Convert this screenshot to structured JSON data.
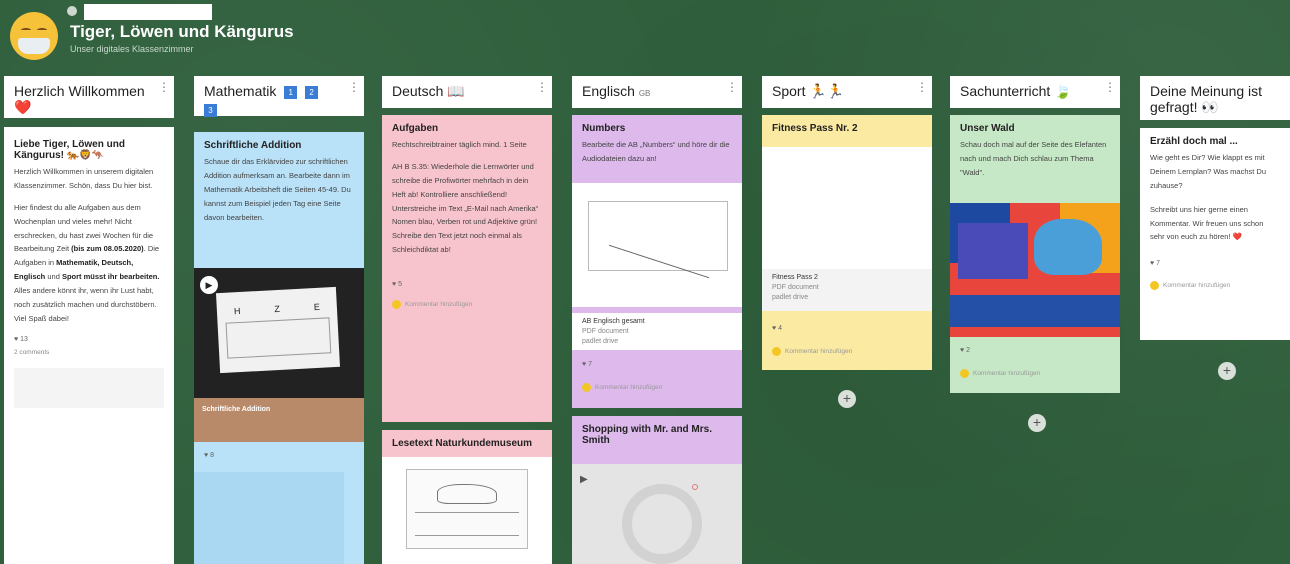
{
  "header": {
    "title": "Tiger, Löwen und Kängurus",
    "subtitle": "Unser digitales Klassenzimmer"
  },
  "columns": [
    {
      "title": "Herzlich Willkommen ❤️",
      "card": {
        "title": "Liebe Tiger, Löwen und Kängurus! 🐅🦁🦘",
        "p1": "Herzlich Willkommen in unserem digitalen Klassenzimmer. Schön, dass Du hier bist.",
        "p2a": "Hier findest du alle Aufgaben aus dem Wochenplan und vieles mehr! Nicht erschrecken, du hast zwei Wochen für die Bearbeitung Zeit ",
        "p2b": "(bis zum 08.05.2020)",
        "p2c": ". Die Aufgaben in ",
        "p2d": "Mathematik, Deutsch, Englisch",
        "p2e": " und ",
        "p2f": "Sport müsst ihr bearbeiten.",
        "p2g": " Alles andere könnt ihr, wenn ihr Lust habt, noch zusätzlich machen und durchstöbern. Viel Spaß dabei!",
        "likes": "13",
        "comments": "2 comments"
      }
    },
    {
      "title": "Mathematik",
      "badges": [
        "1",
        "2",
        "3"
      ],
      "card": {
        "title": "Schriftliche Addition",
        "body": "Schaue dir das Erklärvideo zur schriftlichen Addition aufmerksam an. Bearbeite dann im Mathematik Arbeitsheft die Seiten 45-49. Du kannst zum Beispiel jeden Tag eine Seite davon bearbeiten.",
        "video_caption": "Schriftliche Addition",
        "table_headers": [
          "H",
          "Z",
          "E"
        ],
        "likes": "8"
      }
    },
    {
      "title": "Deutsch 📖",
      "card1": {
        "title": "Aufgaben",
        "p1": "Rechtschreibtrainer täglich mind. 1 Seite",
        "p2": "AH B S.35: Wiederhole die Lernwörter und schreibe die Profiwörter mehrfach in dein Heft ab! Kontrolliere anschließend! Unterstreiche im Text „E-Mail nach Amerika“ Nomen blau, Verben rot und Adjektive grün! Schreibe den Text jetzt noch einmal als Schleichdiktat ab!",
        "likes": "5",
        "comment": "Kommentar hinzufügen"
      },
      "card2": {
        "title": "Lesetext Naturkundemuseum"
      }
    },
    {
      "title": "Englisch",
      "title_suffix": "GB",
      "card1": {
        "title": "Numbers",
        "body": "Bearbeite die AB „Numbers“ und höre dir die Audiodateien dazu an!",
        "file_name": "AB Englisch gesamt",
        "file_type": "PDF document",
        "file_source": "padlet drive",
        "likes": "7",
        "comment": "Kommentar hinzufügen"
      },
      "card2": {
        "title": "Shopping with Mr. and Mrs. Smith"
      }
    },
    {
      "title": "Sport 🏃🏃",
      "card": {
        "title": "Fitness Pass Nr. 2",
        "file_name": "Fitness Pass 2",
        "file_type": "PDF document",
        "file_source": "padlet drive",
        "likes": "4",
        "comment": "Kommentar hinzufügen"
      }
    },
    {
      "title": "Sachunterricht 🍃",
      "card": {
        "title": "Unser Wald",
        "body": "Schau doch mal auf der Seite des Elefanten nach und mach Dich schlau zum Thema \"Wald\".",
        "likes": "2",
        "comment": "Kommentar hinzufügen"
      }
    },
    {
      "title": "Deine Meinung ist gefragt! 👀",
      "card": {
        "title": "Erzähl doch mal ...",
        "p1": "Wie geht es Dir? Wie klappt es mit Deinem Lernplan? Was machst Du zuhause?",
        "p2": "Schreibt uns hier gerne einen Kommentar. Wir freuen uns schon sehr von euch zu hören! ❤️",
        "likes": "7",
        "comment": "Kommentar hinzufügen"
      }
    }
  ],
  "colors": {
    "background": "#2f5f3c",
    "blue": "#b9e1f7",
    "pink": "#f7c3cc",
    "purple": "#ddb9ec",
    "yellow": "#fbeaa2",
    "green": "#c6e8c6",
    "badge": "#3a7dd6"
  }
}
